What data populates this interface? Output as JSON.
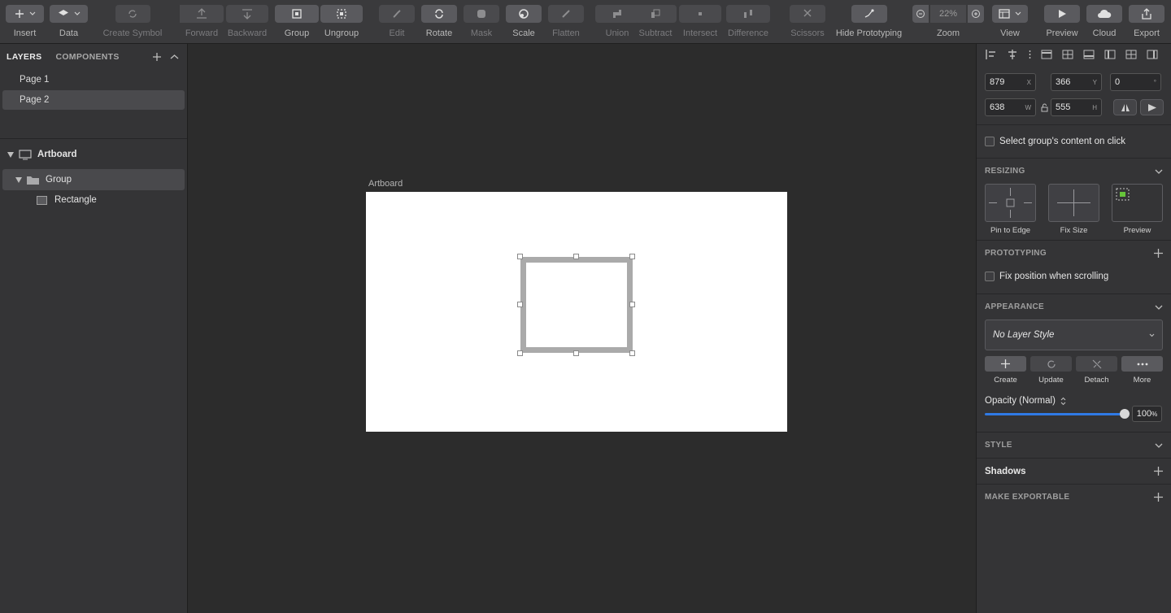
{
  "toolbar": {
    "insert": "Insert",
    "data": "Data",
    "create_symbol": "Create Symbol",
    "forward": "Forward",
    "backward": "Backward",
    "group": "Group",
    "ungroup": "Ungroup",
    "edit": "Edit",
    "rotate": "Rotate",
    "mask": "Mask",
    "scale": "Scale",
    "flatten": "Flatten",
    "union": "Union",
    "subtract": "Subtract",
    "intersect": "Intersect",
    "difference": "Difference",
    "scissors": "Scissors",
    "hide_prototyping": "Hide Prototyping",
    "zoom_label": "Zoom",
    "zoom_value": "22%",
    "view": "View",
    "preview": "Preview",
    "cloud": "Cloud",
    "export": "Export"
  },
  "left_panel": {
    "tab_layers": "LAYERS",
    "tab_components": "COMPONENTS",
    "pages": [
      "Page 1",
      "Page 2"
    ],
    "layers": {
      "artboard": "Artboard",
      "group": "Group",
      "rectangle": "Rectangle"
    }
  },
  "canvas": {
    "artboard_label": "Artboard"
  },
  "inspector": {
    "x_value": "879",
    "x_axis": "X",
    "y_value": "366",
    "y_axis": "Y",
    "rotation_value": "0",
    "rotation_unit": "°",
    "w_value": "638",
    "w_axis": "W",
    "h_value": "555",
    "h_axis": "H",
    "select_group_content": "Select group's content on click",
    "resizing_header": "RESIZING",
    "pin_to_edge": "Pin to Edge",
    "fix_size": "Fix Size",
    "preview": "Preview",
    "prototyping_header": "PROTOTYPING",
    "fix_position": "Fix position when scrolling",
    "appearance_header": "APPEARANCE",
    "layer_style": "No Layer Style",
    "create": "Create",
    "update": "Update",
    "detach": "Detach",
    "more": "More",
    "opacity_label": "Opacity (Normal)",
    "opacity_value": "100",
    "opacity_unit": "%",
    "style_header": "STYLE",
    "shadows": "Shadows",
    "make_exportable": "MAKE EXPORTABLE"
  },
  "colors": {
    "accent": "#2f7ae5",
    "toolbar_bg": "#3a3a3c",
    "panel_bg": "#343436",
    "canvas_bg": "#2c2c2c",
    "artboard_bg": "#ffffff",
    "shape_border": "#aaaaaa"
  }
}
